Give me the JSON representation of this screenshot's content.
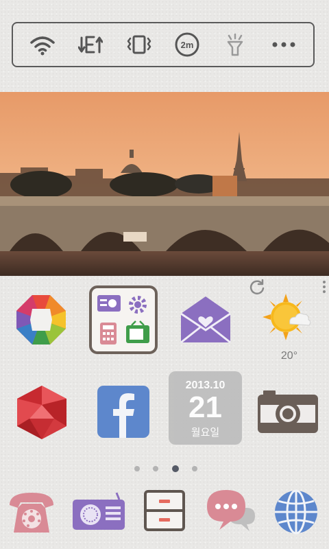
{
  "quick_settings": {
    "screen_timeout_label": "2m"
  },
  "weather": {
    "temperature": "20°"
  },
  "calendar": {
    "year_month": "2013.10",
    "day": "21",
    "weekday": "월요일"
  },
  "pager": {
    "pages": 4,
    "current": 3
  },
  "colors": {
    "background": "#e9e8e6",
    "accent_purple": "#8b6fc0",
    "accent_pink": "#d98a95",
    "accent_blue": "#5d87cc",
    "accent_red": "#d9343a"
  }
}
